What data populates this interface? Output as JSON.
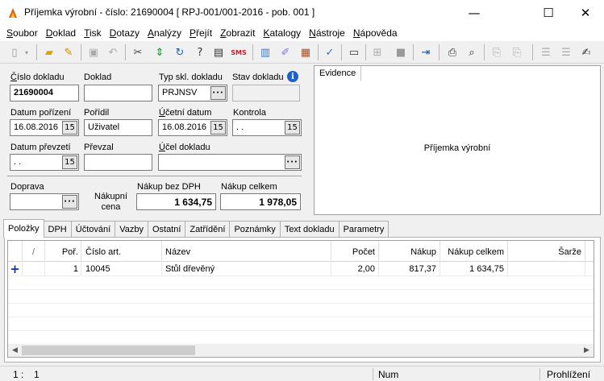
{
  "window": {
    "title": "Příjemka výrobní - číslo: 21690004  [ RPJ-001/001-2016 - pob. 001 ]",
    "controls": {
      "minimize": "—",
      "maximize": "☐",
      "close": "✕"
    }
  },
  "menu": [
    "Soubor",
    "Doklad",
    "Tisk",
    "Dotazy",
    "Analýzy",
    "Přejít",
    "Zobrazit",
    "Katalogy",
    "Nástroje",
    "Nápověda"
  ],
  "toolbar": {
    "icons": [
      "new-document-icon",
      "dropdown-icon",
      "open-folder-icon",
      "edit-icon",
      "save-icon",
      "undo-icon",
      "delete-icon",
      "transfer-icon",
      "refresh-icon",
      "find-icon",
      "print-preview-icon",
      "sms-icon",
      "books-icon",
      "document-pen-icon",
      "package-icon",
      "attachment-icon",
      "folder-icon",
      "tree-icon",
      "stop-icon",
      "export-icon",
      "print-icon",
      "preview-icon",
      "copy-icon",
      "copy2-icon",
      "list-icon",
      "list2-icon",
      "edit-list-icon"
    ]
  },
  "form": {
    "cislo_dokladu": {
      "label": "Číslo dokladu",
      "value": "21690004"
    },
    "doklad": {
      "label": "Doklad",
      "value": ""
    },
    "typ_skl": {
      "label": "Typ skl. dokladu",
      "value": "PRJNSV",
      "button": "···"
    },
    "stav": {
      "label": "Stav dokladu",
      "value": ""
    },
    "datum_porizeni": {
      "label": "Datum pořízení",
      "value": "16.08.2016"
    },
    "poridil": {
      "label": "Pořídil",
      "value": "Uživatel"
    },
    "ucetni_datum": {
      "label": "Účetní datum",
      "value": "16.08.2016"
    },
    "kontrola": {
      "label": "Kontrola",
      "value": ". ."
    },
    "datum_prevzeti": {
      "label": "Datum převzetí",
      "value": ". ."
    },
    "prevzal": {
      "label": "Převzal",
      "value": ""
    },
    "ucel": {
      "label": "Účel dokladu",
      "value": ""
    },
    "doprava": {
      "label": "Doprava",
      "value": ""
    },
    "nakupni_cena": {
      "label": "Nákupní\ncena"
    },
    "nakup_bez_dph": {
      "label": "Nákup bez DPH",
      "value": "1 634,75"
    },
    "nakup_celkem": {
      "label": "Nákup celkem",
      "value": "1 978,05"
    },
    "calendar_glyph": "15"
  },
  "evidence": {
    "tab": "Evidence",
    "content": "Příjemka výrobní"
  },
  "tabs": [
    "Položky",
    "DPH",
    "Účtování",
    "Vazby",
    "Ostatní",
    "Zatřídění",
    "Poznámky",
    "Text dokladu",
    "Parametry"
  ],
  "grid": {
    "columns": [
      "/",
      "Poř.",
      "Číslo art.",
      "Název",
      "Počet",
      "Nákup",
      "Nákup celkem",
      "Šarže"
    ],
    "rows": [
      {
        "por": "1",
        "cislo": "10045",
        "nazev": "Stůl dřevěný",
        "pocet": "2,00",
        "nakup": "817,37",
        "celkem": "1 634,75",
        "sarze": ""
      }
    ]
  },
  "status": {
    "pos1": "1 :",
    "pos2": "1",
    "num": "Num",
    "mode": "Prohlížení"
  }
}
